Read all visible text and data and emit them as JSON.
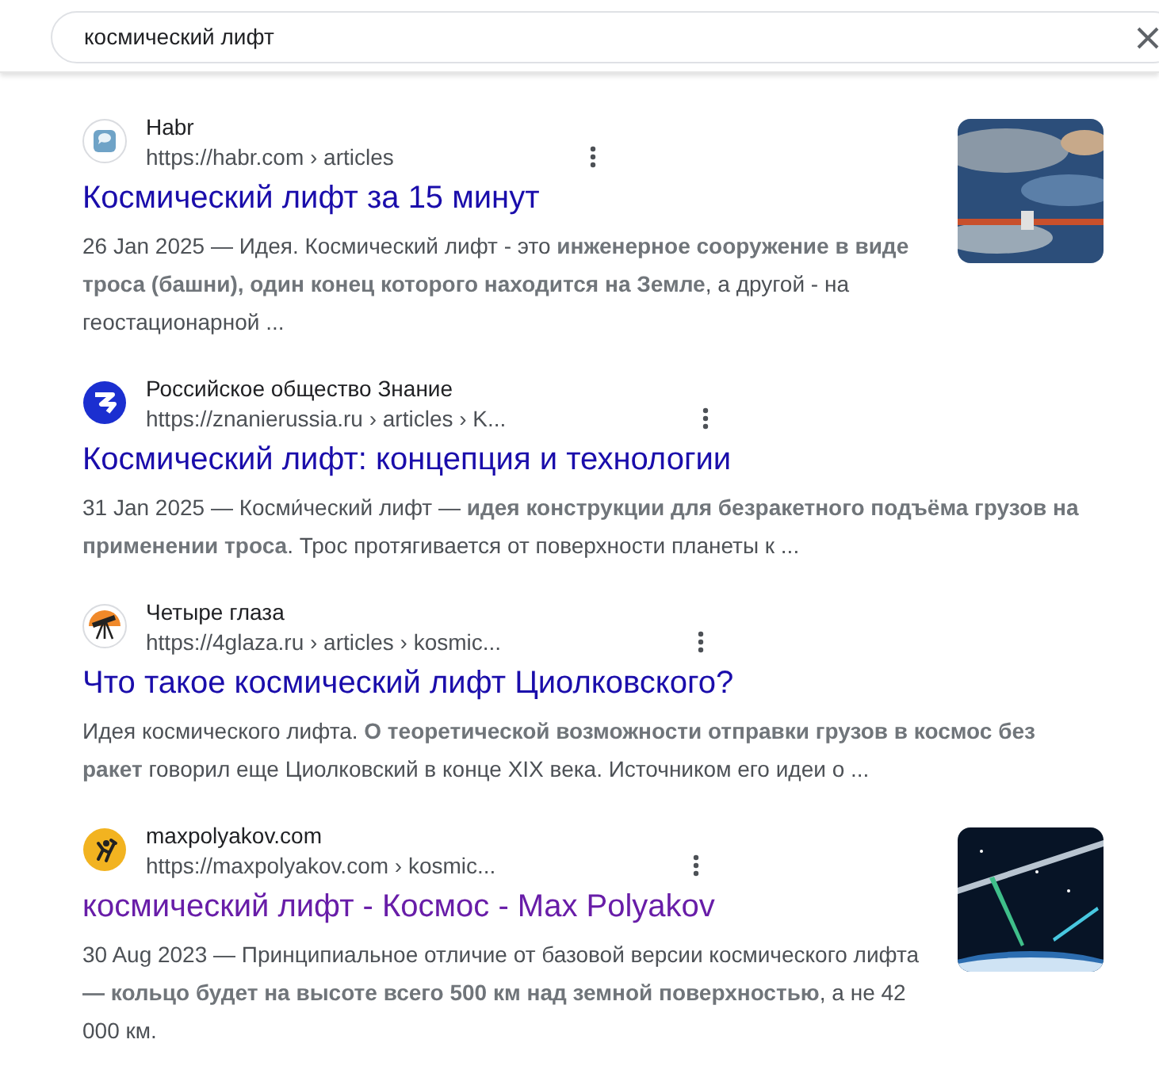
{
  "search": {
    "value": "космический лифт"
  },
  "results": [
    {
      "site": "Habr",
      "url": "https://habr.com › articles",
      "title": "Космический лифт за 15 минут",
      "visited": false,
      "favicon": {
        "kind": "bubble"
      },
      "snippet": "26 Jan 2025 — Идея. Космический лифт - это **инженерное сооружение в виде троса (башни), один конец которого находится на Земле**, а другой - на геостационарной ..."
    },
    {
      "site": "Российское общество Знание",
      "url": "https://znanierussia.ru › articles › K...",
      "title": "Космический лифт: концепция и технологии",
      "visited": false,
      "favicon": {
        "kind": "zlogo"
      },
      "snippet": "31 Jan 2025 — Косми́ческий лифт — **идея конструкции для безракетного подъёма грузов на применении троса**. Трос протягивается от поверхности планеты к ..."
    },
    {
      "site": "Четыре глаза",
      "url": "https://4glaza.ru › articles › kosmic...",
      "title": "Что такое космический лифт Циолковского?",
      "visited": false,
      "favicon": {
        "kind": "telescope"
      },
      "snippet": "Идея космического лифта. **О теоретической возможности отправки грузов в космос без ракет** говорил еще Циолковский в конце XIX века. Источником его идеи о ..."
    },
    {
      "site": "maxpolyakov.com",
      "url": "https://maxpolyakov.com › kosmic...",
      "title": "космический лифт - Космос - Max Polyakov",
      "visited": true,
      "favicon": {
        "kind": "figure"
      },
      "snippet": "30 Aug 2023 — Принципиальное отличие от базовой версии космического лифта **— кольцо будет на высоте всего 500 км над земной поверхностью**, а не 42 000 км."
    }
  ]
}
